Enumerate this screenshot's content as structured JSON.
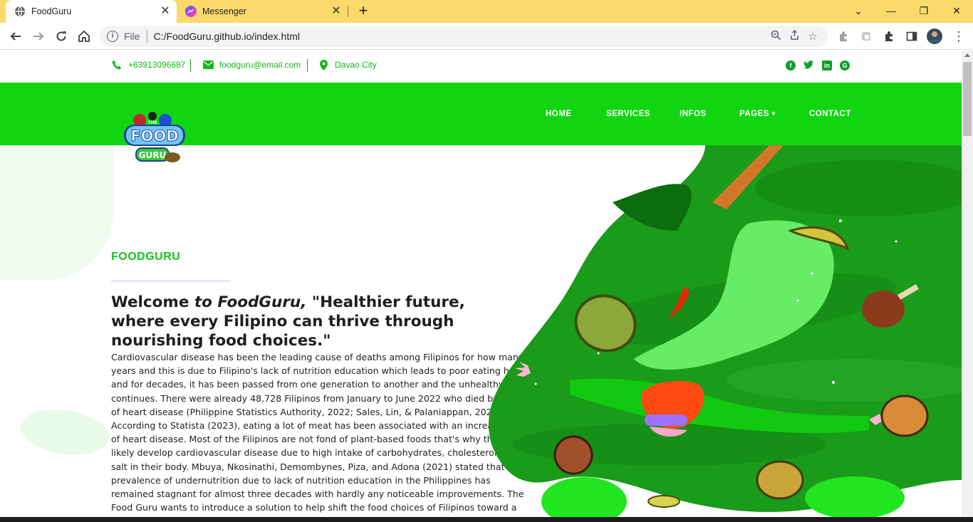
{
  "browser": {
    "tabs": [
      {
        "title": "FoodGuru",
        "active": true,
        "favicon": "globe-icon"
      },
      {
        "title": "Messenger",
        "active": false,
        "favicon": "messenger-icon"
      }
    ],
    "address": {
      "scheme": "File",
      "url": "C:/FoodGuru.github.io/index.html"
    },
    "tabbar_color": "#fbd96b"
  },
  "site": {
    "topbar": {
      "phone": "+63913096687",
      "email": "foodguru@email.com",
      "location": "Davao City",
      "socials": [
        "facebook-icon",
        "twitter-icon",
        "linkedin-icon",
        "google-plus-icon"
      ]
    },
    "nav": {
      "items": [
        "HOME",
        "SERVICES",
        "INFOS",
        "PAGES",
        "CONTACT"
      ],
      "color": "#12d512"
    },
    "logo": {
      "text_top": "THE",
      "text_main": "FOOD",
      "text_sub": "GURU"
    },
    "hero": {
      "eyebrow": "FOODGURU",
      "headline_part1": "Welcome ",
      "headline_em": "to FoodGuru,",
      "headline_part2": " \"Healthier future, where every Filipino can thrive through nourishing food choices.\"",
      "body": "Cardiovascular disease has been the leading cause of deaths among Filipinos for how many years and this is due to Filipino's lack of nutrition education which leads to poor eating habits and for decades, it has been passed from one generation to another and the unhealthy cycle continues. There were already 48,728 Filipinos from January to June 2022 who died because of heart disease (Philippine Statistics Authority, 2022; Sales, Lin, & Palaniappan, 2020). According to Statista (2023), eating a lot of meat has been associated with an increased risk of heart disease. Most of the Filipinos are not fond of plant-based foods that's why they most likely develop cardiovascular disease due to high intake of carbohydrates, cholesterol, and salt in their body. Mbuya, Nkosinathi, Demombynes, Piza, and Adona (2021) stated that the prevalence of undernutrition due to lack of nutrition education in the Philippines has remained stagnant for almost three decades with hardly any noticeable improvements. The Food Guru wants to introduce a solution to help shift the food choices of Filipinos toward a healthy diet, a sustainable environment, and a just food system for all"
    }
  }
}
